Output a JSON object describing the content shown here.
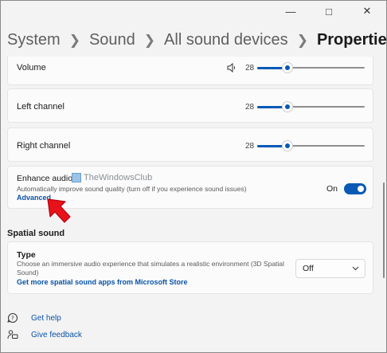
{
  "breadcrumb": {
    "items": [
      "System",
      "Sound",
      "All sound devices"
    ],
    "current": "Properties"
  },
  "volume": {
    "label": "Volume",
    "value": "28",
    "level": 0.28
  },
  "left_channel": {
    "label": "Left channel",
    "value": "28",
    "level": 0.28
  },
  "right_channel": {
    "label": "Right channel",
    "value": "28",
    "level": 0.28
  },
  "enhance_audio": {
    "title": "Enhance audio",
    "watermark": "TheWindowsClub",
    "description": "Automatically improve sound quality (turn off if you experience sound issues)",
    "advanced_link": "Advanced",
    "toggle_state": "On"
  },
  "spatial_sound": {
    "section_title": "Spatial sound",
    "type_label": "Type",
    "description_line1": "Choose an immersive audio experience that simulates a realistic environment (3D Spatial",
    "description_line2": "Sound)",
    "store_link": "Get more spatial sound apps from Microsoft Store",
    "selected": "Off"
  },
  "footer": {
    "help": "Get help",
    "feedback": "Give feedback"
  },
  "colors": {
    "accent": "#0059b5",
    "arrow": "#e8121b"
  }
}
